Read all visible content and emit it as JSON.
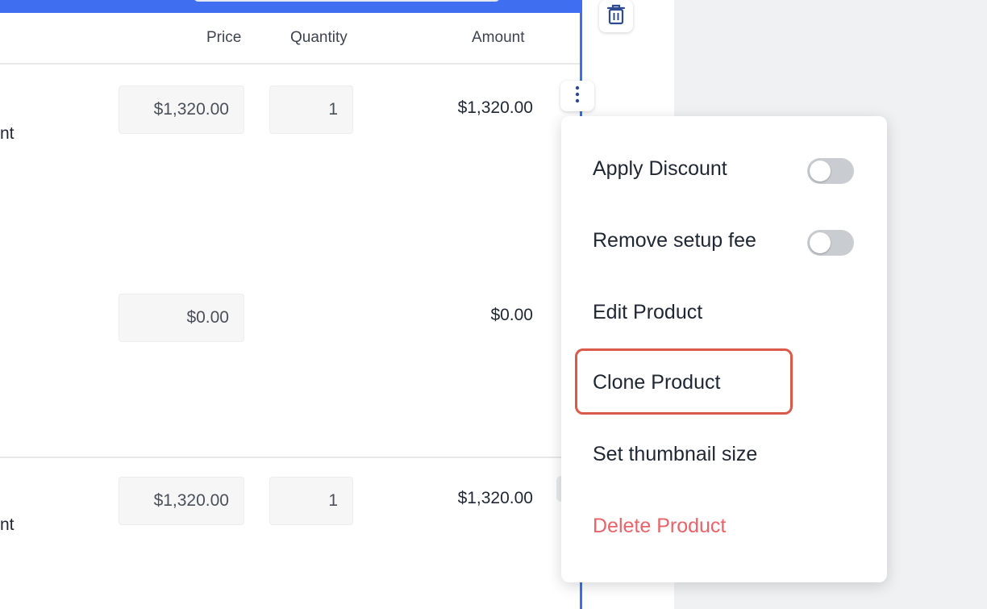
{
  "table": {
    "headers": {
      "price": "Price",
      "quantity": "Quantity",
      "amount": "Amount"
    },
    "rows": [
      {
        "label_fragment": "nt",
        "price": "$1,320.00",
        "quantity": "1",
        "amount": "$1,320.00"
      },
      {
        "price": "$0.00",
        "amount": "$0.00"
      },
      {
        "label_fragment": "nt",
        "price": "$1,320.00",
        "quantity": "1",
        "amount": "$1,320.00"
      }
    ]
  },
  "menu": {
    "items": [
      {
        "label": "Apply Discount",
        "toggle": false
      },
      {
        "label": "Remove setup fee",
        "toggle": false
      },
      {
        "label": "Edit Product"
      },
      {
        "label": "Clone Product",
        "highlighted": true
      },
      {
        "label": "Set thumbnail size"
      },
      {
        "label": "Delete Product",
        "danger": true
      }
    ]
  },
  "icons": {
    "trash": "trash-icon",
    "more": "more-vertical-icon"
  },
  "colors": {
    "accent": "#3f6ff0",
    "danger": "#e8636a",
    "highlight": "#d9594a"
  }
}
